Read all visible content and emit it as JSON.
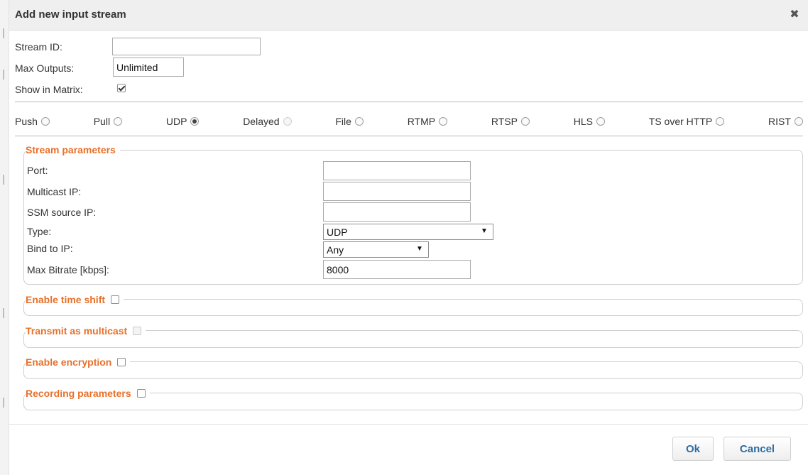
{
  "dialog": {
    "title": "Add new input stream"
  },
  "general": {
    "stream_id_label": "Stream ID:",
    "stream_id_value": "",
    "max_outputs_label": "Max Outputs:",
    "max_outputs_value": "Unlimited",
    "show_in_matrix_label": "Show in Matrix:",
    "show_in_matrix_checked": true
  },
  "modes": [
    {
      "label": "Push",
      "selected": false,
      "disabled": false
    },
    {
      "label": "Pull",
      "selected": false,
      "disabled": false
    },
    {
      "label": "UDP",
      "selected": true,
      "disabled": false
    },
    {
      "label": "Delayed",
      "selected": false,
      "disabled": true
    },
    {
      "label": "File",
      "selected": false,
      "disabled": false
    },
    {
      "label": "RTMP",
      "selected": false,
      "disabled": false
    },
    {
      "label": "RTSP",
      "selected": false,
      "disabled": false
    },
    {
      "label": "HLS",
      "selected": false,
      "disabled": false
    },
    {
      "label": "TS over HTTP",
      "selected": false,
      "disabled": false
    },
    {
      "label": "RIST",
      "selected": false,
      "disabled": false
    }
  ],
  "stream_params": {
    "legend": "Stream parameters",
    "port_label": "Port:",
    "port_value": "",
    "multicast_ip_label": "Multicast IP:",
    "multicast_ip_value": "",
    "ssm_source_ip_label": "SSM source IP:",
    "ssm_source_ip_value": "",
    "type_label": "Type:",
    "type_value": "UDP",
    "bind_to_ip_label": "Bind to IP:",
    "bind_to_ip_value": "Any",
    "max_bitrate_label": "Max Bitrate [kbps]:",
    "max_bitrate_value": "8000"
  },
  "sections": {
    "time_shift": "Enable time shift",
    "multicast": "Transmit as multicast",
    "encryption": "Enable encryption",
    "recording": "Recording parameters"
  },
  "buttons": {
    "ok": "Ok",
    "cancel": "Cancel"
  },
  "icons": {
    "close": "close-icon"
  },
  "colors": {
    "legend": "#e8702a",
    "button_text": "#2d6ca2",
    "titlebar": "#efefef"
  }
}
